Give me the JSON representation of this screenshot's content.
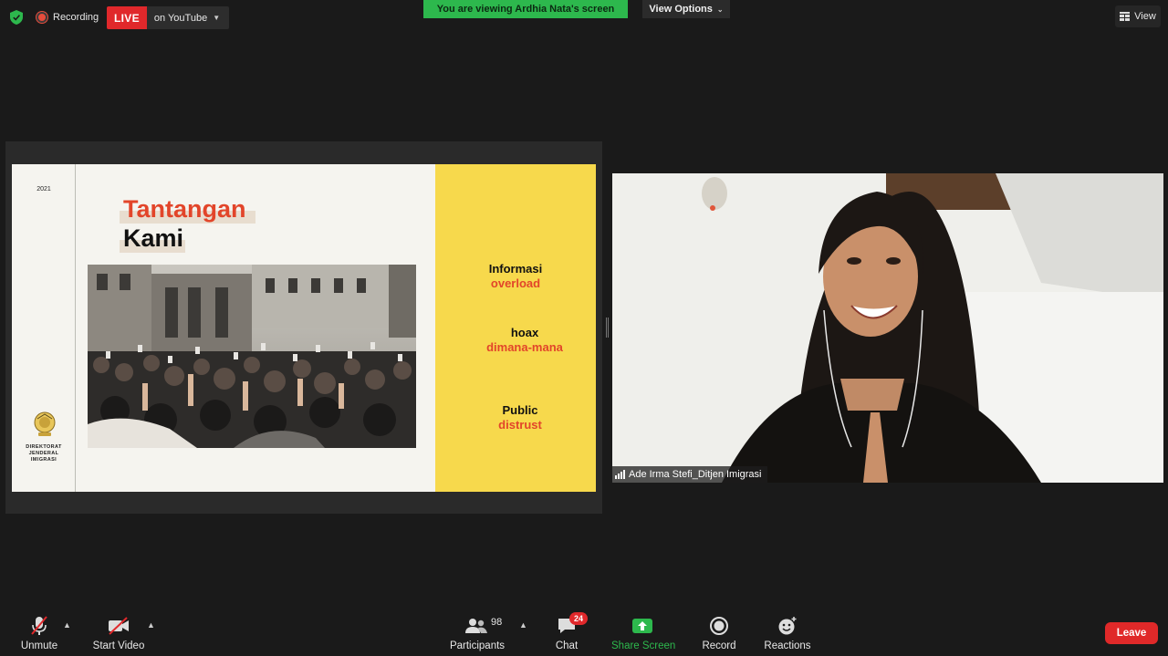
{
  "top_bar": {
    "recording_label": "Recording",
    "live_badge": "LIVE",
    "live_destination": "on YouTube",
    "viewing_banner": "You are viewing Ardhia Nata's screen",
    "view_options_label": "View Options",
    "view_label": "View"
  },
  "slide": {
    "year": "2021",
    "title_line1": "Tantangan",
    "title_line2": "Kami",
    "org_name": "DIREKTORAT\nJENDERAL\nIMIGRASI",
    "points": [
      {
        "line1": "Informasi",
        "line2": "overload"
      },
      {
        "line1": "hoax",
        "line2": "dimana-mana"
      },
      {
        "line1": "Public",
        "line2": "distrust"
      }
    ]
  },
  "video": {
    "participant_name": "Ade Irma Stefi_Ditjen Imigrasi"
  },
  "toolbar": {
    "unmute_label": "Unmute",
    "start_video_label": "Start Video",
    "participants_label": "Participants",
    "participants_count": "98",
    "chat_label": "Chat",
    "chat_badge": "24",
    "share_screen_label": "Share Screen",
    "record_label": "Record",
    "reactions_label": "Reactions",
    "leave_label": "Leave"
  },
  "colors": {
    "background": "#1a1a1a",
    "banner_green": "#2db84d",
    "live_red": "#e0282b",
    "slide_accent_red": "#e2452a",
    "slide_yellow": "#f7d94c",
    "share_icon_green": "#2db84d"
  }
}
